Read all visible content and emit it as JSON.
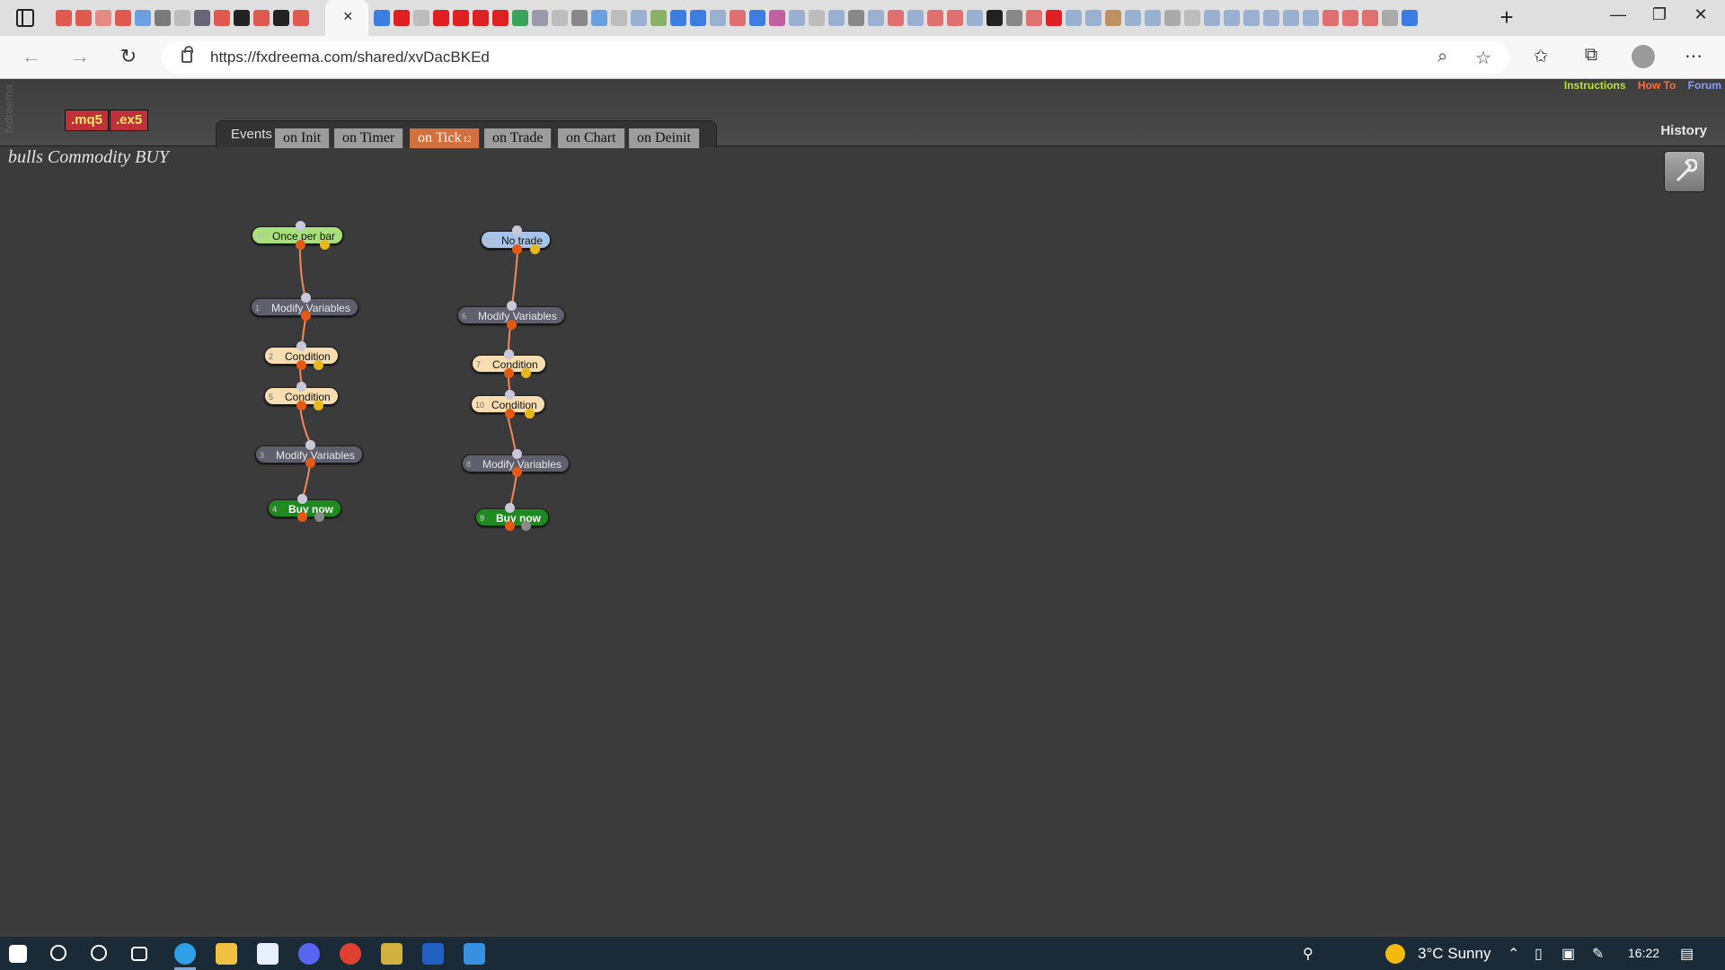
{
  "browser": {
    "url": "https://fxdreema.com/shared/xvDacBKEd",
    "close_tab_glyph": "×",
    "new_tab_glyph": "+"
  },
  "app": {
    "brand": "fxdreema",
    "export_buttons": [
      ".mq5",
      ".ex5"
    ],
    "top_links": {
      "instructions": "Instructions",
      "howto": "How To",
      "forum": "Forum"
    },
    "events_label": "Events",
    "tabs": [
      {
        "label": "on Init"
      },
      {
        "label": "on Timer"
      },
      {
        "label": "on Tick",
        "count": "12",
        "active": true
      },
      {
        "label": "on Trade"
      },
      {
        "label": "on Chart"
      },
      {
        "label": "on Deinit"
      }
    ],
    "history_label": "History",
    "project_title": "bulls Commodity BUY"
  },
  "blocks": {
    "b427": {
      "id": "427",
      "label": "Once per bar"
    },
    "b1": {
      "id": "1",
      "label": "Modify Variables"
    },
    "b2": {
      "id": "2",
      "label": "Condition"
    },
    "b5": {
      "id": "5",
      "label": "Condition"
    },
    "b3": {
      "id": "3",
      "label": "Modify Variables"
    },
    "b4": {
      "id": "4",
      "label": "Buy now"
    },
    "b11": {
      "id": "11",
      "label": "No trade"
    },
    "b6": {
      "id": "6",
      "label": "Modify Variables"
    },
    "b7": {
      "id": "7",
      "label": "Condition"
    },
    "b10": {
      "id": "10",
      "label": "Condition"
    },
    "b8": {
      "id": "8",
      "label": "Modify Variables"
    },
    "b9": {
      "id": "9",
      "label": "Buy now"
    }
  },
  "taskbar": {
    "weather": "3°C  Sunny",
    "time": "16:22"
  },
  "colors": {
    "accent_tab": "#d3703f",
    "block_output": "#e45a14",
    "buy_block": "#1f8a1f"
  }
}
